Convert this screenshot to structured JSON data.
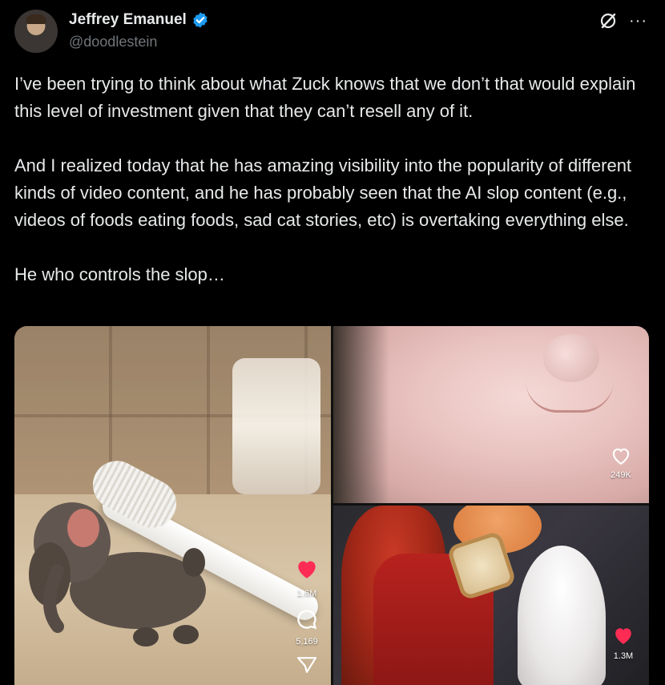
{
  "author": {
    "name": "Jeffrey Emanuel",
    "handle": "@doodlestein",
    "verified": true,
    "verified_color": "#1d9bf0"
  },
  "icons": {
    "grok": "grok-icon",
    "more": "more-icon"
  },
  "tweet": {
    "text": "I’ve been trying to think about what Zuck knows that we don’t that would explain this level of investment given that they can’t resell any of it.\n\nAnd I realized today that he has amazing visibility into the popularity of different kinds of video content, and he has probably seen that the AI slop content (e.g., videos of foods eating foods, sad cat stories, etc) is overtaking everything else.\n\nHe who controls the slop…"
  },
  "media": {
    "left": {
      "likes": "1.6M",
      "comments": "5,169",
      "like_color": "#fe2c55"
    },
    "top_right": {
      "likes": "249K"
    },
    "bottom_right": {
      "likes": "1.3M",
      "like_color": "#fe2c55"
    }
  }
}
